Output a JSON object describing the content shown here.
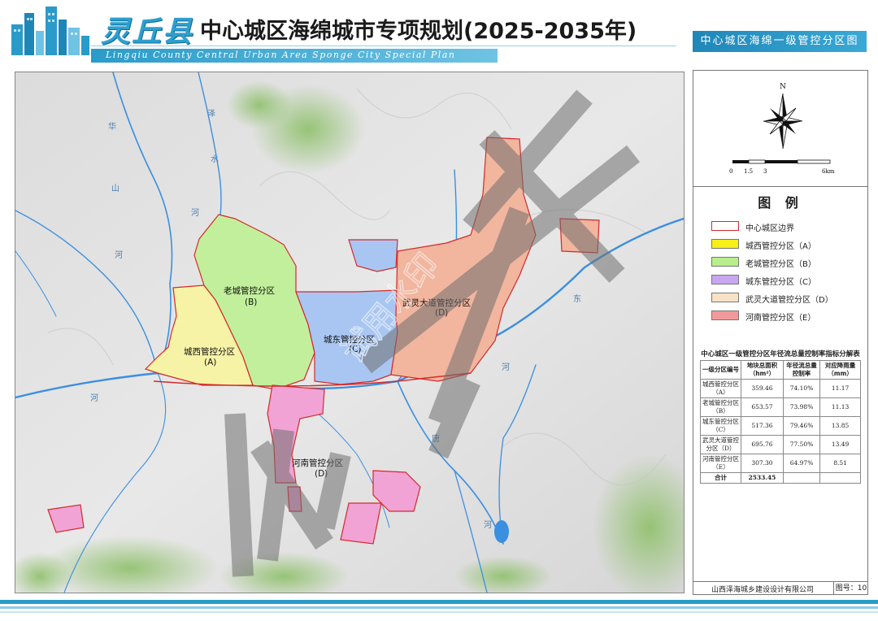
{
  "header": {
    "county": "灵丘县",
    "title": "中心城区海绵城市专项规划(2025-2035年)",
    "subtitle": "Lingqiu County Central Urban Area Sponge City Special Plan",
    "badge": "中心城区海绵一级管控分区图"
  },
  "map": {
    "zones": [
      {
        "name": "城西管控分区",
        "code": "(A)",
        "color": "#f7f3a6"
      },
      {
        "name": "老城管控分区",
        "code": "(B)",
        "color": "#c2ef9c"
      },
      {
        "name": "城东管控分区",
        "code": "(C)",
        "color": "#a9c6f2"
      },
      {
        "name": "武灵大道管控分区",
        "code": "(D)",
        "color": "#f2b59e"
      },
      {
        "name": "河南管控分区",
        "code": "(D)",
        "color": "#f2a3d6"
      }
    ],
    "zone_labels": {
      "a1": "城西管控分区",
      "a2": "(A)",
      "b1": "老城管控分区",
      "b2": "(B)",
      "c1": "城东管控分区",
      "c2": "(C)",
      "d1": "武灵大道管控分区",
      "d2": "(D)",
      "e1": "河南管控分区",
      "e2": "(D)"
    },
    "river_chars": [
      "华",
      "山",
      "河",
      "泽",
      "水",
      "河",
      "唐",
      "河",
      "河",
      "东",
      "河"
    ],
    "watermark": "试用水印",
    "colors": {
      "river": "#3b8fe0",
      "boundary": "#d42a2a"
    }
  },
  "compass": {
    "north": "N"
  },
  "scale": {
    "ticks": [
      "0",
      "1.5",
      "3",
      "6km"
    ]
  },
  "legend": {
    "title": "图 例",
    "items": [
      {
        "label": "中心城区边界",
        "fill": "#ffffff",
        "border": "#d42a2a"
      },
      {
        "label": "城西管控分区（A）",
        "fill": "#f7ef1a",
        "border": "#777777"
      },
      {
        "label": "老城管控分区（B）",
        "fill": "#b8ef8c",
        "border": "#777777"
      },
      {
        "label": "城东管控分区（C）",
        "fill": "#c9a6f2",
        "border": "#777777"
      },
      {
        "label": "武灵大道管控分区（D）",
        "fill": "#f7e2c6",
        "border": "#777777"
      },
      {
        "label": "河南管控分区（E）",
        "fill": "#f29a9a",
        "border": "#777777"
      }
    ]
  },
  "table": {
    "title": "中心城区一级管控分区年径流总量控制率指标分解表",
    "headers": [
      "一级分区编号",
      "地块总面积（hm²）",
      "年径流总量控制率",
      "对应降雨量（mm）"
    ],
    "rows": [
      [
        "城西管控分区（A）",
        "359.46",
        "74.10%",
        "11.17"
      ],
      [
        "老城管控分区（B）",
        "653.57",
        "73.98%",
        "11.13"
      ],
      [
        "城东管控分区（C）",
        "517.36",
        "79.46%",
        "13.85"
      ],
      [
        "武灵大道管控分区（D）",
        "695.76",
        "77.50%",
        "13.49"
      ],
      [
        "河南管控分区（E）",
        "307.30",
        "64.97%",
        "8.51"
      ],
      [
        "合计",
        "2533.45",
        "",
        ""
      ]
    ]
  },
  "footer": {
    "company": "山西泽海城乡建设设计有限公司",
    "figure_no": "图号：10"
  }
}
